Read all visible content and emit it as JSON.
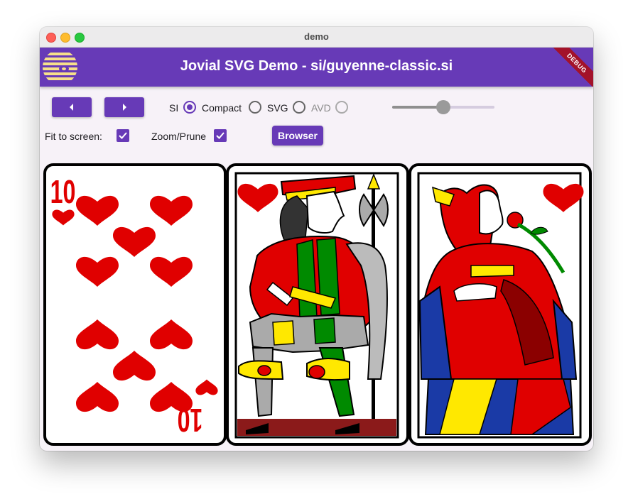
{
  "window": {
    "title": "demo"
  },
  "appbar": {
    "title": "Jovial SVG Demo - si/guyenne-classic.si",
    "debug_label": "DEBUG"
  },
  "toolbar": {
    "prev_icon": "caret-left-icon",
    "next_icon": "caret-right-icon",
    "format_options": [
      {
        "label": "SI",
        "selected": true,
        "enabled": true
      },
      {
        "label": "Compact",
        "selected": false,
        "enabled": true
      },
      {
        "label": "SVG",
        "selected": false,
        "enabled": true
      },
      {
        "label": "AVD",
        "selected": false,
        "enabled": false
      }
    ],
    "slider_value": 0.5,
    "fit_label": "Fit to screen:",
    "fit_checked": true,
    "zoom_label": "Zoom/Prune",
    "zoom_checked": true,
    "browser_label": "Browser"
  },
  "cards": [
    {
      "name": "ten-of-hearts",
      "rank": "10",
      "suit": "heart"
    },
    {
      "name": "jack-of-hearts",
      "figure": "jack",
      "suit": "heart"
    },
    {
      "name": "queen-of-hearts",
      "figure": "queen",
      "suit": "heart"
    }
  ],
  "colors": {
    "accent": "#673ab7",
    "heart": "#e00000",
    "debug": "#a3122a"
  }
}
